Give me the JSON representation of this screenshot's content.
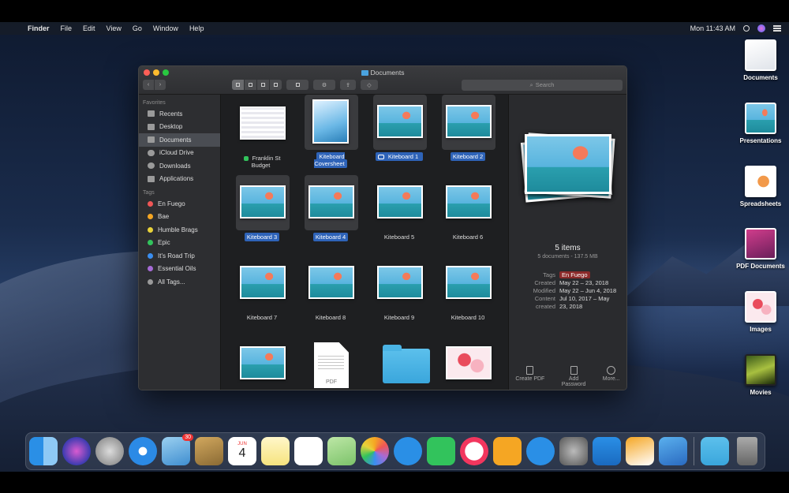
{
  "menubar": {
    "apple": "",
    "items": [
      "Finder",
      "File",
      "Edit",
      "View",
      "Go",
      "Window",
      "Help"
    ],
    "clock": "Mon 11:43 AM"
  },
  "desktop_icons": [
    {
      "label": "Documents"
    },
    {
      "label": "Presentations"
    },
    {
      "label": "Spreadsheets"
    },
    {
      "label": "PDF Documents"
    },
    {
      "label": "Images"
    },
    {
      "label": "Movies"
    }
  ],
  "window": {
    "title": "Documents",
    "search_placeholder": "Search",
    "search_glyph": "⌕",
    "share_glyph": "⇪",
    "tag_glyph": "◇",
    "nav_back": "‹",
    "nav_forward": "›",
    "sidebar": {
      "favorites_header": "Favorites",
      "favorites": [
        "Recents",
        "Desktop",
        "Documents",
        "iCloud Drive",
        "Downloads",
        "Applications"
      ],
      "selected": "Documents",
      "tags_header": "Tags",
      "tags": [
        {
          "label": "En Fuego",
          "color": "#f05656"
        },
        {
          "label": "Bae",
          "color": "#f5a623"
        },
        {
          "label": "Humble Brags",
          "color": "#e8d23a"
        },
        {
          "label": "Epic",
          "color": "#32c35c"
        },
        {
          "label": "It's Road Trip",
          "color": "#3a8ef0"
        },
        {
          "label": "Essential Oils",
          "color": "#a66bd6"
        },
        {
          "label": "All Tags...",
          "color": "#9a9a9a"
        }
      ]
    },
    "files": [
      {
        "name": "Franklin St Budget",
        "kind": "sheet",
        "selected": false,
        "tag": "green"
      },
      {
        "name": "Kiteboard Coversheet",
        "kind": "cover",
        "selected": true,
        "tag": ""
      },
      {
        "name": "Kiteboard 1",
        "kind": "surf",
        "selected": true,
        "tag": "red"
      },
      {
        "name": "Kiteboard 2",
        "kind": "surf",
        "selected": true,
        "tag": ""
      },
      {
        "name": "Kiteboard 3",
        "kind": "surf",
        "selected": true,
        "tag": ""
      },
      {
        "name": "Kiteboard 4",
        "kind": "surf",
        "selected": true,
        "tag": ""
      },
      {
        "name": "Kiteboard 5",
        "kind": "surf",
        "selected": false,
        "tag": ""
      },
      {
        "name": "Kiteboard 6",
        "kind": "surf",
        "selected": false,
        "tag": ""
      },
      {
        "name": "Kiteboard 7",
        "kind": "surf",
        "selected": false,
        "tag": ""
      },
      {
        "name": "Kiteboard 8",
        "kind": "surf",
        "selected": false,
        "tag": ""
      },
      {
        "name": "Kiteboard 9",
        "kind": "surf",
        "selected": false,
        "tag": ""
      },
      {
        "name": "Kiteboard 10",
        "kind": "surf",
        "selected": false,
        "tag": ""
      },
      {
        "name": "",
        "kind": "surf",
        "selected": false,
        "tag": ""
      },
      {
        "name": "",
        "kind": "pdf",
        "selected": false,
        "tag": ""
      },
      {
        "name": "",
        "kind": "folder",
        "selected": false,
        "tag": ""
      },
      {
        "name": "",
        "kind": "flowers",
        "selected": false,
        "tag": ""
      }
    ],
    "pdf_label": "PDF",
    "preview": {
      "title": "5 items",
      "subtitle": "5 documents - 137.5 MB",
      "tags_key": "Tags",
      "tags_val": "En Fuego",
      "created_key": "Created",
      "created_val": "May 22 – 23, 2018",
      "modified_key": "Modified",
      "modified_val": "May 22 – Jun 4, 2018",
      "content_key": "Content",
      "content_val": "Jul 10, 2017 – May",
      "content_key2": "created",
      "content_val2": "23, 2018",
      "actions": [
        {
          "label": "Create PDF"
        },
        {
          "label": "Add Password"
        },
        {
          "label": "More..."
        }
      ]
    }
  },
  "dock": {
    "calendar_month": "JUN",
    "calendar_day": "4",
    "mail_badge": "30"
  }
}
